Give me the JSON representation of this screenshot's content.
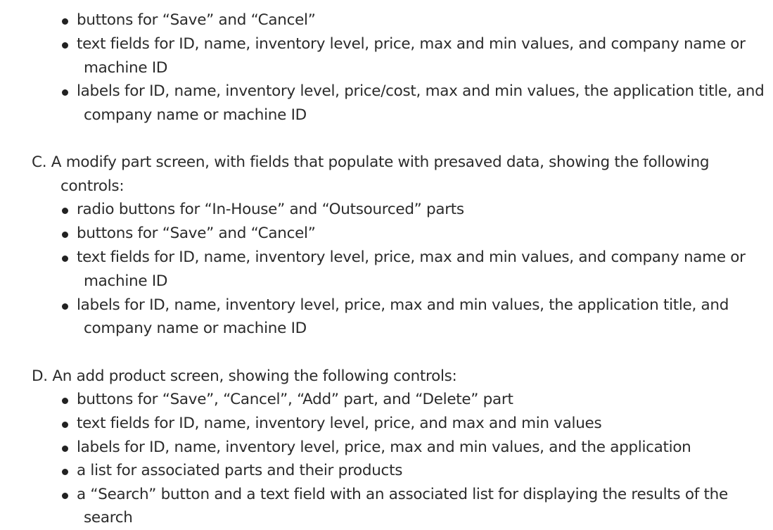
{
  "section_b_tail": {
    "bullets": [
      [
        "buttons for “Save” and “Cancel”"
      ],
      [
        "text fields for ID, name, inventory level, price, max and min values, and company name or",
        "machine ID"
      ],
      [
        "labels for ID, name, inventory level, price/cost, max and min values, the application title, and",
        "company name or machine ID"
      ]
    ]
  },
  "section_c": {
    "heading": [
      "C. A modify part screen, with fields that populate with presaved data, showing the following",
      "controls:"
    ],
    "bullets": [
      [
        "radio buttons for “In-House” and “Outsourced” parts"
      ],
      [
        "buttons for “Save” and “Cancel”"
      ],
      [
        "text fields for ID, name, inventory level, price, max and min values, and company name or",
        "machine ID"
      ],
      [
        "labels for ID, name, inventory level, price, max and min values, the application title, and",
        "company name or machine ID"
      ]
    ]
  },
  "section_d": {
    "heading": [
      "D. An add product screen, showing the following controls:"
    ],
    "bullets": [
      [
        "buttons for “Save”, “Cancel”, “Add” part, and “Delete” part"
      ],
      [
        "text fields for ID, name, inventory level, price, and max and min values"
      ],
      [
        "labels for ID, name, inventory level, price, max and min values, and the application"
      ],
      [
        "a list for associated parts and their products"
      ],
      [
        "a “Search” button and a text field with an associated list for displaying the results of the",
        "search"
      ]
    ]
  }
}
